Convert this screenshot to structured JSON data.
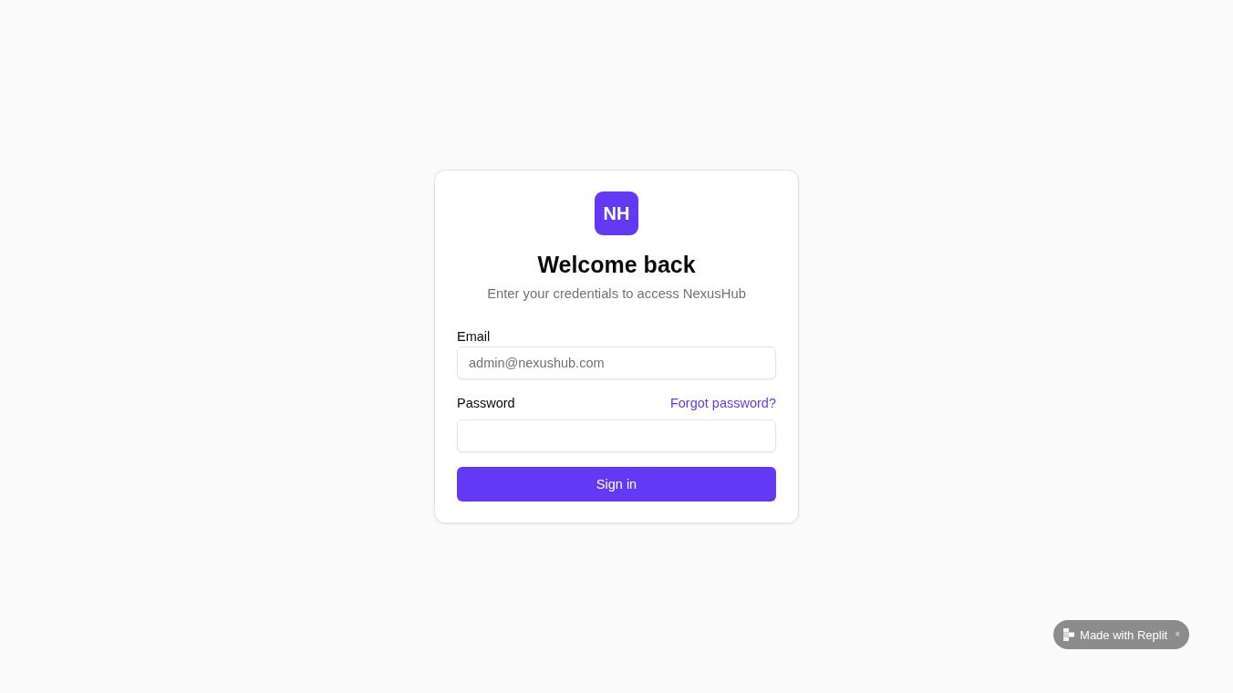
{
  "logo": {
    "initials": "NH"
  },
  "heading": "Welcome back",
  "subtitle": "Enter your credentials to access NexusHub",
  "fields": [
    {
      "label": "Email",
      "placeholder": "admin@nexushub.com"
    },
    {
      "label": "Password",
      "link": "Forgot password?"
    }
  ],
  "submit": {
    "label": "Sign in"
  },
  "badge": {
    "label": "Made with Replit",
    "close": "×"
  }
}
